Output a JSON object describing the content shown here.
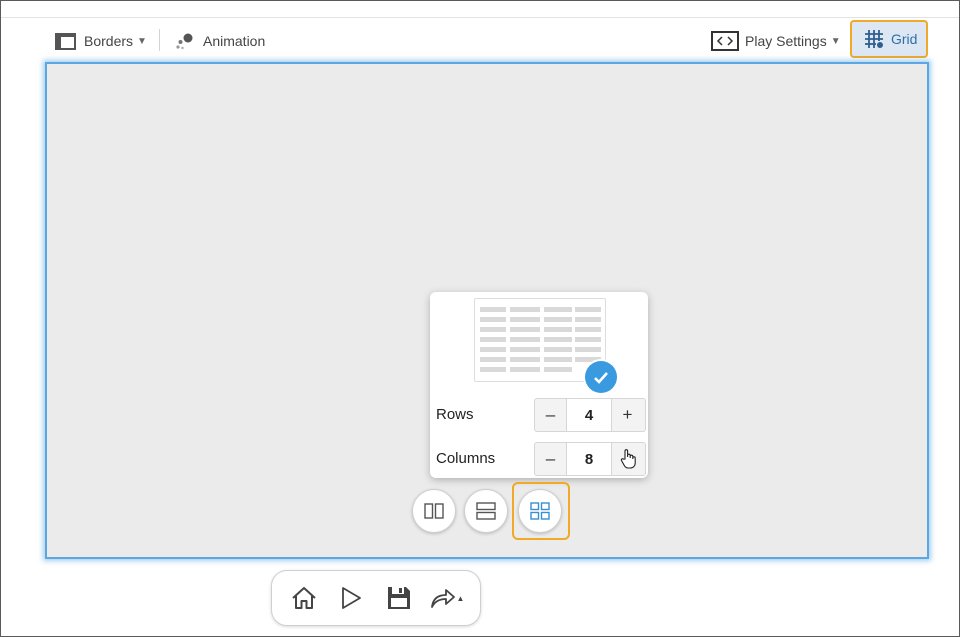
{
  "toolbar": {
    "borders_label": "Borders",
    "animation_label": "Animation",
    "play_settings_label": "Play Settings",
    "grid_label": "Grid"
  },
  "grid_popup": {
    "rows_label": "Rows",
    "rows_value": "4",
    "columns_label": "Columns",
    "columns_value": "8",
    "minus_symbol": "–",
    "plus_symbol": "+"
  },
  "layout_buttons": [
    "split-vertical",
    "split-horizontal",
    "grid-2x2"
  ],
  "bottom_toolbar": [
    "home-icon",
    "play-icon",
    "save-icon",
    "share-icon"
  ],
  "colors": {
    "accent": "#3a9ae0",
    "highlight": "#f0a928",
    "canvas": "#ebebeb",
    "canvas_border": "#5aa7e3"
  }
}
